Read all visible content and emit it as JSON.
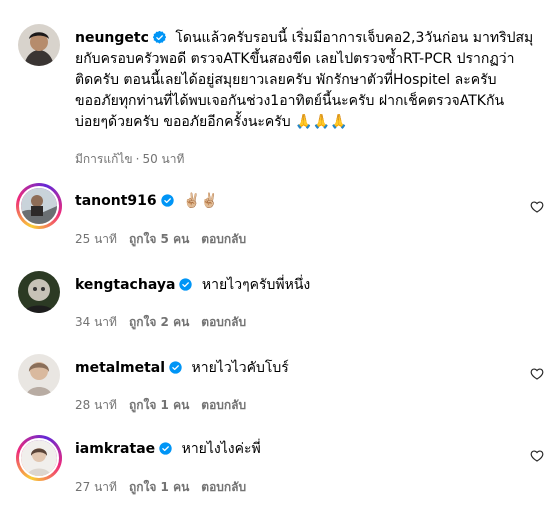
{
  "post": {
    "username": "neungetc",
    "lines": [
      "โดนแล้วครับรอบนี้ เริ่มมีอาการเจ็บคอ2,3วันก่อน มาทริปสมุ",
      "ยกับครอบครัวพอดี ตรวจATKขึ้นสองขีด เลยไปตรวจซ้ำRT-PCR ปรากฏว่า",
      "ติดครับ ตอนนี้เลยได้อยู่สมุยยาวเลยครับ พักรักษาตัวที่Hospitel ละครับ",
      "ขออภัยทุกท่านที่ได้พบเจอกันช่วง1อาทิตย์นี้นะครับ ฝากเช็คตรวจATKกัน",
      "บ่อยๆด้วยครับ ขออภัยอีกครั้งนะครับ 🙏🙏🙏"
    ],
    "edited": "มีการแก้ไข",
    "dot": "·",
    "time": "50 นาที"
  },
  "comments": [
    {
      "username": "tanont916",
      "text": "✌🏼✌🏼",
      "time": "25 นาที",
      "likes": "ถูกใจ 5 คน",
      "reply": "ตอบกลับ"
    },
    {
      "username": "kengtachaya",
      "text": "หายไวๆครับพี่หนึ่ง",
      "time": "34 นาที",
      "likes": "ถูกใจ 2 คน",
      "reply": "ตอบกลับ"
    },
    {
      "username": "metalmetal",
      "text": "หายไวไวคับโบร์",
      "time": "28 นาที",
      "likes": "ถูกใจ 1 คน",
      "reply": "ตอบกลับ"
    },
    {
      "username": "iamkratae",
      "text": "หายไงไงค่ะพี่",
      "time": "27 นาที",
      "likes": "ถูกใจ 1 คน",
      "reply": "ตอบกลับ"
    }
  ],
  "icons": {
    "verified": "verified-badge-icon",
    "like": "heart-outline-icon"
  },
  "colors": {
    "verified": "#0095f6",
    "meta_text": "#737373",
    "text": "#000000"
  }
}
